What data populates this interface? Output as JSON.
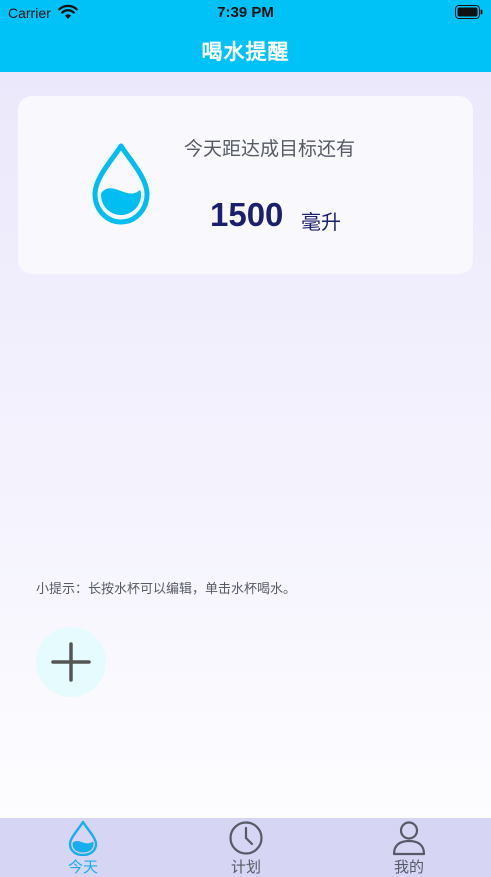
{
  "status_bar": {
    "carrier": "Carrier",
    "time": "7:39 PM"
  },
  "nav": {
    "title": "喝水提醒"
  },
  "goal_card": {
    "label": "今天距达成目标还有",
    "amount": "1500",
    "unit": "毫升"
  },
  "tip": {
    "text": "小提示：长按水杯可以编辑，单击水杯喝水。"
  },
  "tabs": [
    {
      "label": "今天",
      "icon": "water-drop-icon",
      "selected": true
    },
    {
      "label": "计划",
      "icon": "clock-icon",
      "selected": false
    },
    {
      "label": "我的",
      "icon": "person-icon",
      "selected": false
    }
  ],
  "colors": {
    "accent": "#00c2f6",
    "tab_selected": "#17aef0",
    "tab_bar": "#d6d6f4",
    "amount_text": "#1a1f6e"
  }
}
